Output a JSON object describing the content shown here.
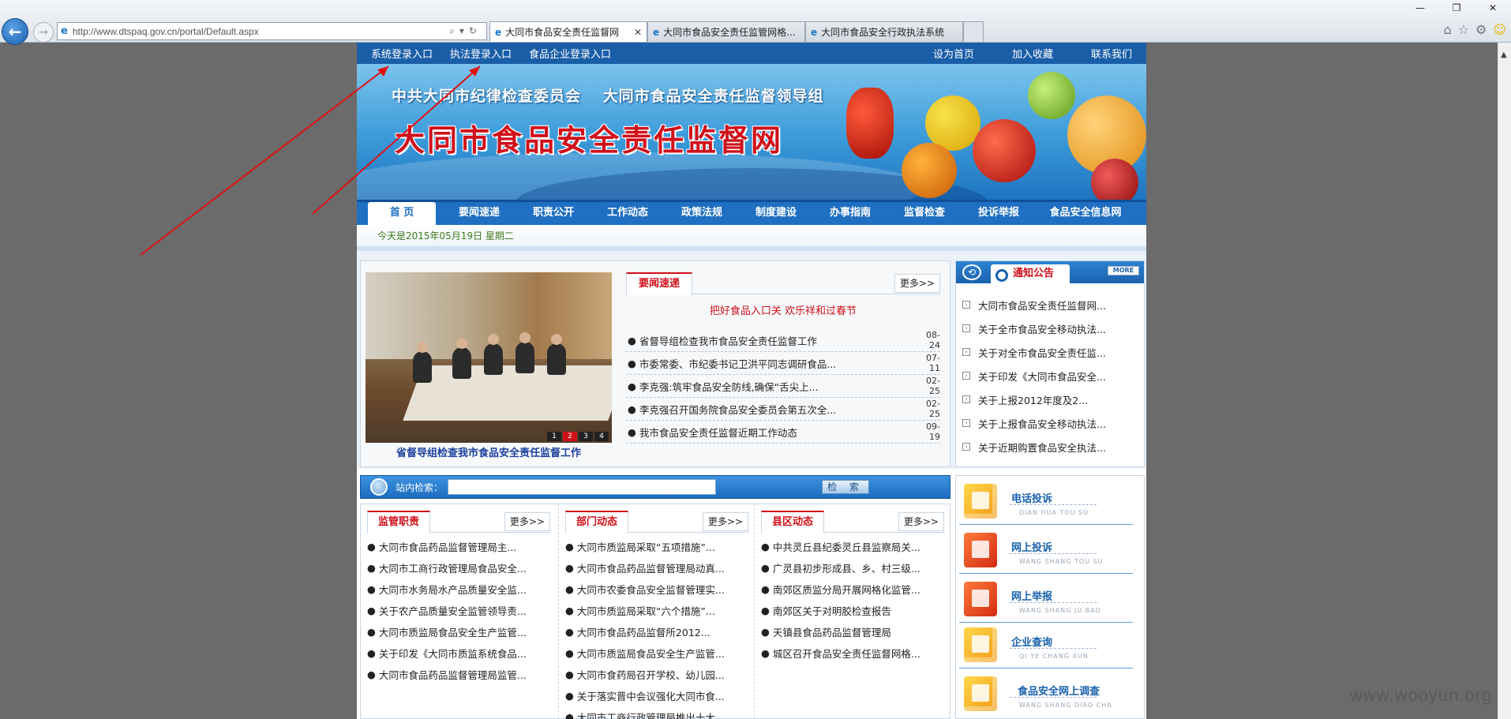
{
  "browser": {
    "address": "http://www.dtspaq.gov.cn/portal/Default.aspx",
    "tabs": [
      {
        "title": "大同市食品安全责任监督网",
        "active": true
      },
      {
        "title": "大同市食品安全责任监管网格...",
        "active": false
      },
      {
        "title": "大同市食品安全行政执法系统",
        "active": false
      }
    ]
  },
  "topbar": {
    "left": [
      "系统登录入口",
      "执法登录入口",
      "食品企业登录入口"
    ],
    "right": [
      "设为首页",
      "加入收藏",
      "联系我们"
    ]
  },
  "banner": {
    "subtitle": "中共大同市纪律检查委员会 大同市食品安全责任监督领导组",
    "title": "大同市食品安全责任监督网"
  },
  "mainnav": [
    "首 页",
    "要闻速递",
    "职责公开",
    "工作动态",
    "政策法规",
    "制度建设",
    "办事指南",
    "监督检查",
    "投诉举报",
    "食品安全信息网"
  ],
  "date_text": "今天是2015年05月19日 星期二",
  "photo": {
    "caption": "省督导组检查我市食品安全责任监督工作",
    "pager": [
      "1",
      "2",
      "3",
      "4"
    ]
  },
  "news": {
    "tab": "要闻速递",
    "more": "更多>>",
    "headline": "把好食品入口关 欢乐祥和过春节",
    "items": [
      {
        "title": "省督导组检查我市食品安全责任监督工作",
        "date": "08-24"
      },
      {
        "title": "市委常委、市纪委书记卫洪平同志调研食品...",
        "date": "07-11"
      },
      {
        "title": "李克强:筑牢食品安全防线,确保“舌尖上...",
        "date": "02-25"
      },
      {
        "title": "李克强召开国务院食品安全委员会第五次全...",
        "date": "02-25"
      },
      {
        "title": "我市食品安全责任监督近期工作动态",
        "date": "09-19"
      }
    ]
  },
  "notice": {
    "tab": "通知公告",
    "more": "MORE",
    "items": [
      "大同市食品安全责任监督网...",
      "关于全市食品安全移动执法...",
      "关于对全市食品安全责任监...",
      "关于印发《大同市食品安全...",
      "关于上报2012年度及2...",
      "关于上报食品安全移动执法...",
      "关于近期购置食品安全执法..."
    ]
  },
  "search": {
    "label": "站内检索：",
    "button": "检 索"
  },
  "columns": [
    {
      "tab": "监管职责",
      "more": "更多>>",
      "items": [
        "大同市食品药品监督管理局主...",
        "大同市工商行政管理局食品安全...",
        "大同市水务局水产品质量安全监...",
        "关于农产品质量安全监管领导责...",
        "大同市质监局食品安全生产监管...",
        "关于印发《大同市质监系统食品...",
        "大同市食品药品监督管理局监管..."
      ]
    },
    {
      "tab": "部门动态",
      "more": "更多>>",
      "items": [
        "大同市质监局采取“五项措施”...",
        "大同市食品药品监督管理局动真...",
        "大同市农委食品安全监督管理实...",
        "大同市质监局采取“六个措施”...",
        "大同市食品药品监督所2012...",
        "大同市质监局食品安全生产监管...",
        "大同市食药局召开学校、幼儿园...",
        "关于落实晋中会议强化大同市食...",
        "大同市工商行政管理局推出十大..."
      ]
    },
    {
      "tab": "县区动态",
      "more": "更多>>",
      "items": [
        "中共灵丘县纪委灵丘县监察局关...",
        "广灵县初步形成县、乡、村三级...",
        "南郊区质监分局开展网格化监管...",
        "南郊区关于对明胶检查报告",
        "天镇县食品药品监督管理局",
        "城区召开食品安全责任监督网格..."
      ]
    }
  ],
  "services": [
    {
      "name": "电话投诉",
      "pinyin": "DIAN HUA TOU SU",
      "icon": "phone-icon"
    },
    {
      "name": "网上投诉",
      "pinyin": "WANG SHANG TOU SU",
      "icon": "mail-icon"
    },
    {
      "name": "网上举报",
      "pinyin": "WANG SHANG JU BAO",
      "icon": "mail-icon"
    },
    {
      "name": "企业查询",
      "pinyin": "QI YE CHANG XUN",
      "icon": "computer-icon"
    },
    {
      "name": "食品安全网上调查",
      "pinyin": "WANG SHANG DIAO CHA",
      "icon": "survey-icon"
    }
  ],
  "watermark": "www.wooyun.org"
}
